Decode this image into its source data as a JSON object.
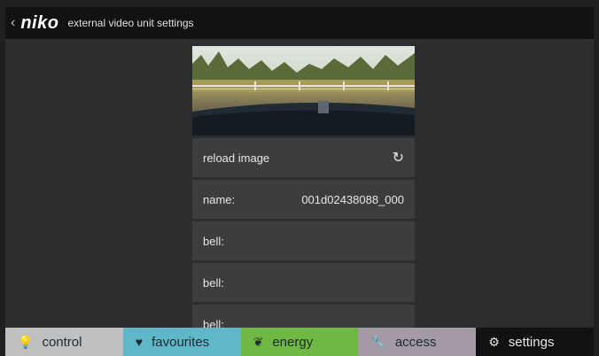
{
  "header": {
    "back_icon": "chevron-left-icon",
    "brand": "niko",
    "title": "external video unit settings"
  },
  "main": {
    "preview_alt": "camera-preview",
    "rows": [
      {
        "label": "reload image",
        "value": "",
        "icon": "reload-icon"
      },
      {
        "label": "name:",
        "value": "001d02438088_000"
      },
      {
        "label": "bell:",
        "value": ""
      },
      {
        "label": "bell:",
        "value": ""
      },
      {
        "label": "bell:",
        "value": ""
      }
    ]
  },
  "tabs": [
    {
      "label": "control",
      "icon": "lightbulb-icon",
      "color": "#bfc0c1"
    },
    {
      "label": "favourites",
      "icon": "heart-icon",
      "color": "#5fb8c7"
    },
    {
      "label": "energy",
      "icon": "leaf-icon",
      "color": "#6fb844"
    },
    {
      "label": "access",
      "icon": "wrench-icon",
      "color": "#a39aa6"
    },
    {
      "label": "settings",
      "icon": "gears-icon",
      "color": "#111213"
    }
  ]
}
